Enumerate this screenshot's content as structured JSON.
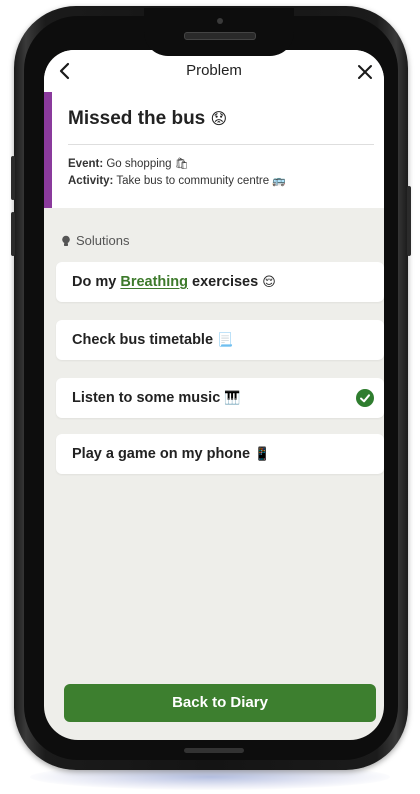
{
  "header": {
    "title": "Problem",
    "back_icon": "chevron-left-icon",
    "close_icon": "close-icon"
  },
  "problem": {
    "title": "Missed the bus",
    "title_emoji": "😟",
    "event_label": "Event:",
    "event_value": "Go shopping",
    "event_emoji": "🛍",
    "activity_label": "Activity:",
    "activity_value": "Take bus to community centre",
    "activity_emoji": "🚌",
    "accent_color": "#8a3a9c"
  },
  "solutions": {
    "heading": "Solutions",
    "heading_icon": "lightbulb-icon",
    "items": [
      {
        "prefix": "Do my ",
        "link": "Breathing",
        "suffix": " exercises",
        "emoji": "😌",
        "selected": false
      },
      {
        "prefix": "Check bus timetable",
        "link": "",
        "suffix": "",
        "emoji": "📃",
        "selected": false
      },
      {
        "prefix": "Listen to some music",
        "link": "",
        "suffix": "",
        "emoji": "🎹",
        "selected": true
      },
      {
        "prefix": "Play a game on my phone",
        "link": "",
        "suffix": "",
        "emoji": "📱",
        "selected": false
      }
    ]
  },
  "footer": {
    "button_label": "Back to Diary",
    "button_color": "#3d7f2f"
  }
}
